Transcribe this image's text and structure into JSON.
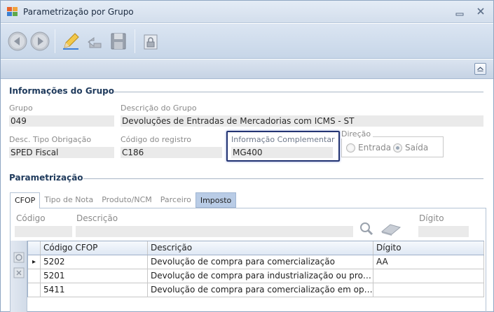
{
  "window": {
    "title": "Parametrização por Grupo"
  },
  "grupo_section": {
    "title": "Informações do Grupo",
    "grupo_label": "Grupo",
    "grupo_value": "049",
    "descricao_label": "Descrição do Grupo",
    "descricao_value": "Devoluções de Entradas de Mercadorias com ICMS - ST",
    "tipo_obrigacao_label": "Desc. Tipo Obrigação",
    "tipo_obrigacao_value": "SPED Fiscal",
    "codigo_registro_label": "Código do registro",
    "codigo_registro_value": "C186",
    "info_complementar_label": "Informação Complementar",
    "info_complementar_value": "MG400",
    "direcao_label": "Direção",
    "direcao_entrada": "Entrada",
    "direcao_saida": "Saída"
  },
  "parametrizacao": {
    "title": "Parametrização",
    "tabs": [
      "CFOP",
      "Tipo de Nota",
      "Produto/NCM",
      "Parceiro",
      "Imposto"
    ],
    "filter": {
      "codigo_label": "Código",
      "descricao_label": "Descrição",
      "digito_label": "Dígito"
    },
    "grid": {
      "columns": [
        "Código CFOP",
        "Descrição",
        "Dígito"
      ],
      "rows": [
        {
          "codigo": "5202",
          "descricao": "Devolução de compra para comercialização",
          "digito": "AA"
        },
        {
          "codigo": "5201",
          "descricao": "Devolução de compra para industrialização ou produçã...",
          "digito": ""
        },
        {
          "codigo": "5411",
          "descricao": "Devolução de compra para comercialização em operaçã...",
          "digito": ""
        }
      ],
      "current_row_marker": "▸"
    }
  },
  "colors": {
    "highlight_border": "#233473",
    "section_title": "#1f3a5c",
    "tab_blue": "#b9cce6"
  }
}
